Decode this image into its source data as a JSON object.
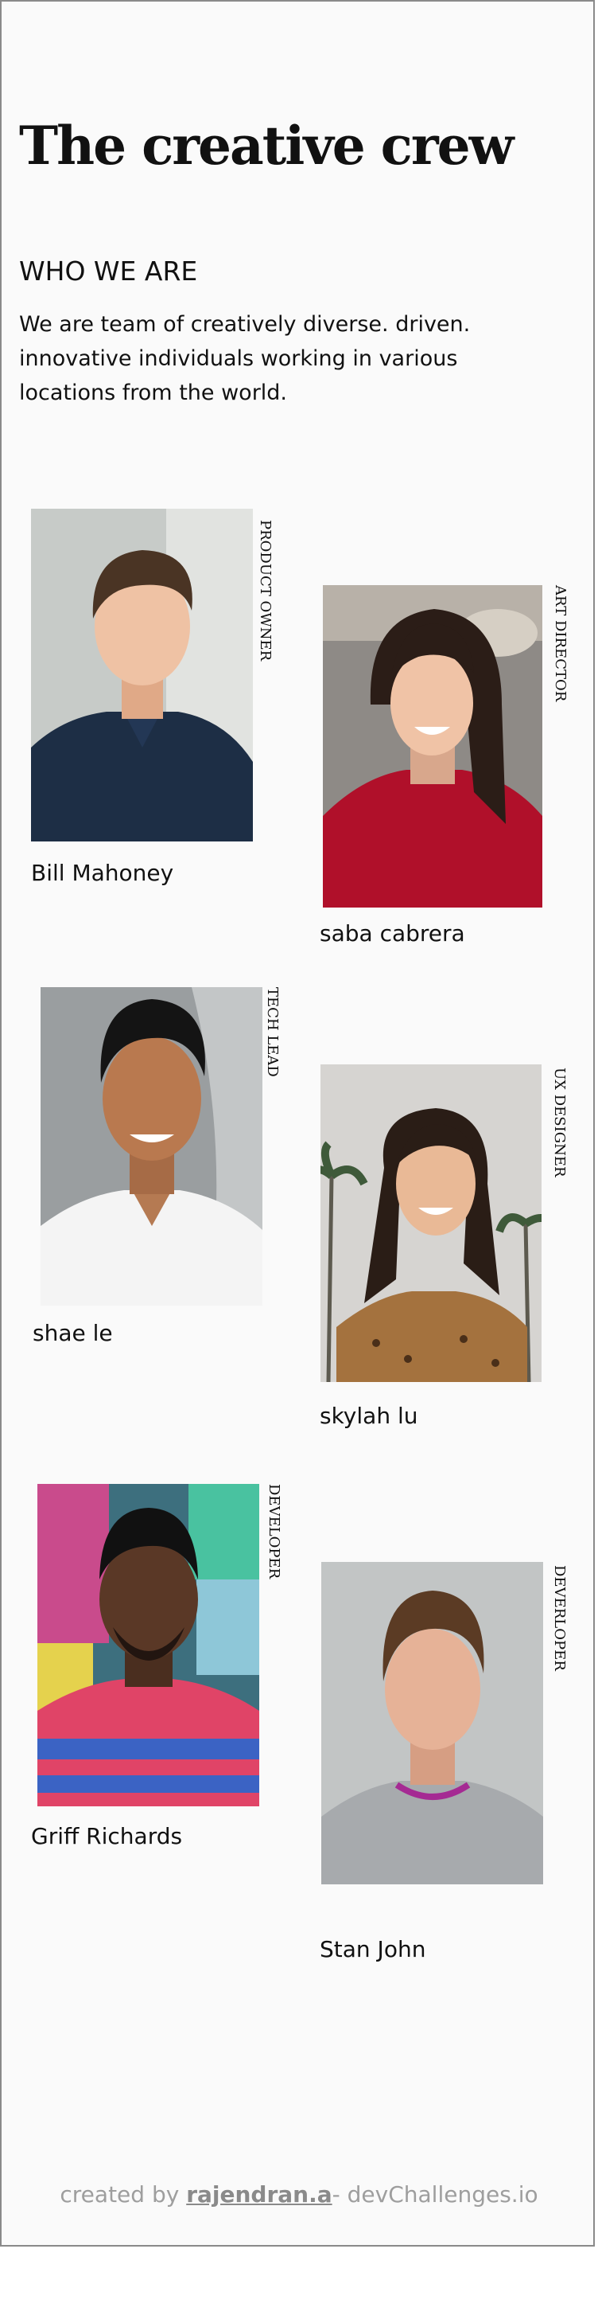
{
  "header": {
    "title": "The creative crew",
    "subtitle": "WHO WE ARE",
    "intro": "We are team of creatively diverse. driven. innovative individuals working in various locations from the world."
  },
  "members": [
    {
      "name": "Bill Mahoney",
      "role": "PRODUCT OWNER",
      "photo": "portrait-man-navy-polo"
    },
    {
      "name": "saba cabrera",
      "role": "ART DIRECTOR",
      "photo": "portrait-woman-red-sweater"
    },
    {
      "name": "shae le",
      "role": "TECH LEAD",
      "photo": "portrait-man-white-tshirt"
    },
    {
      "name": "skylah lu",
      "role": "UX DESIGNER",
      "photo": "portrait-woman-palm-trees"
    },
    {
      "name": "Griff Richards",
      "role": "DEVELOPER",
      "photo": "portrait-man-striped-shirt"
    },
    {
      "name": "Stan John",
      "role": "DEVERLOPER",
      "photo": "portrait-man-grey-sweater"
    }
  ],
  "footer": {
    "prefix": "created by",
    "author": "rajendran.a",
    "suffix": "- devChallenges.io"
  },
  "colors": {
    "background": "#fafafa",
    "text": "#111111",
    "footer_text": "#9e9e9e",
    "border": "#8a8a8a"
  }
}
